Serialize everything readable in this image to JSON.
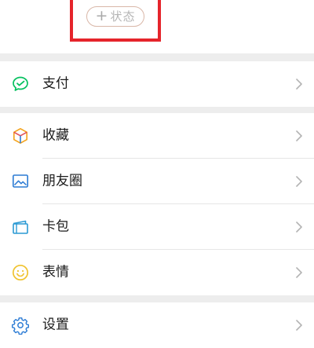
{
  "status": {
    "plus": "+",
    "label": "状态"
  },
  "colors": {
    "background": "#ededed",
    "highlight_box": "#e5242b",
    "pay_icon": "#07c160",
    "favorites_icon": "#f4a21a",
    "moments_icon": "#2b7bd4",
    "cards_icon": "#2b9ad4",
    "sticker_icon": "#f0c330",
    "settings_icon": "#2b7bd4"
  },
  "menu": {
    "pay": {
      "label": "支付",
      "icon": "wechat-pay-icon"
    },
    "favorites": {
      "label": "收藏",
      "icon": "cube-icon"
    },
    "moments": {
      "label": "朋友圈",
      "icon": "picture-icon"
    },
    "cards": {
      "label": "卡包",
      "icon": "card-wallet-icon"
    },
    "stickers": {
      "label": "表情",
      "icon": "smiley-icon"
    },
    "settings": {
      "label": "设置",
      "icon": "gear-icon"
    }
  }
}
